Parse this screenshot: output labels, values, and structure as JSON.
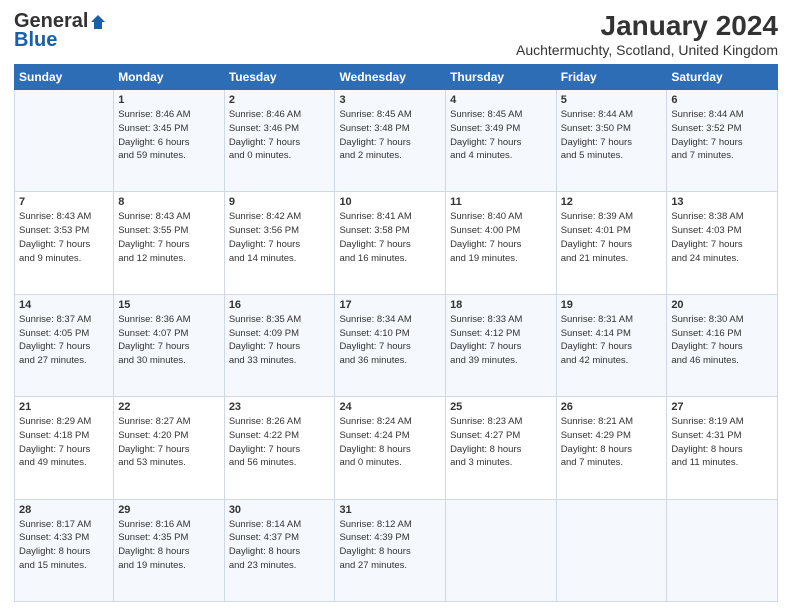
{
  "header": {
    "logo_general": "General",
    "logo_blue": "Blue",
    "main_title": "January 2024",
    "sub_title": "Auchtermuchty, Scotland, United Kingdom"
  },
  "columns": [
    "Sunday",
    "Monday",
    "Tuesday",
    "Wednesday",
    "Thursday",
    "Friday",
    "Saturday"
  ],
  "rows": [
    [
      {
        "day": "",
        "lines": []
      },
      {
        "day": "1",
        "lines": [
          "Sunrise: 8:46 AM",
          "Sunset: 3:45 PM",
          "Daylight: 6 hours",
          "and 59 minutes."
        ]
      },
      {
        "day": "2",
        "lines": [
          "Sunrise: 8:46 AM",
          "Sunset: 3:46 PM",
          "Daylight: 7 hours",
          "and 0 minutes."
        ]
      },
      {
        "day": "3",
        "lines": [
          "Sunrise: 8:45 AM",
          "Sunset: 3:48 PM",
          "Daylight: 7 hours",
          "and 2 minutes."
        ]
      },
      {
        "day": "4",
        "lines": [
          "Sunrise: 8:45 AM",
          "Sunset: 3:49 PM",
          "Daylight: 7 hours",
          "and 4 minutes."
        ]
      },
      {
        "day": "5",
        "lines": [
          "Sunrise: 8:44 AM",
          "Sunset: 3:50 PM",
          "Daylight: 7 hours",
          "and 5 minutes."
        ]
      },
      {
        "day": "6",
        "lines": [
          "Sunrise: 8:44 AM",
          "Sunset: 3:52 PM",
          "Daylight: 7 hours",
          "and 7 minutes."
        ]
      }
    ],
    [
      {
        "day": "7",
        "lines": [
          "Sunrise: 8:43 AM",
          "Sunset: 3:53 PM",
          "Daylight: 7 hours",
          "and 9 minutes."
        ]
      },
      {
        "day": "8",
        "lines": [
          "Sunrise: 8:43 AM",
          "Sunset: 3:55 PM",
          "Daylight: 7 hours",
          "and 12 minutes."
        ]
      },
      {
        "day": "9",
        "lines": [
          "Sunrise: 8:42 AM",
          "Sunset: 3:56 PM",
          "Daylight: 7 hours",
          "and 14 minutes."
        ]
      },
      {
        "day": "10",
        "lines": [
          "Sunrise: 8:41 AM",
          "Sunset: 3:58 PM",
          "Daylight: 7 hours",
          "and 16 minutes."
        ]
      },
      {
        "day": "11",
        "lines": [
          "Sunrise: 8:40 AM",
          "Sunset: 4:00 PM",
          "Daylight: 7 hours",
          "and 19 minutes."
        ]
      },
      {
        "day": "12",
        "lines": [
          "Sunrise: 8:39 AM",
          "Sunset: 4:01 PM",
          "Daylight: 7 hours",
          "and 21 minutes."
        ]
      },
      {
        "day": "13",
        "lines": [
          "Sunrise: 8:38 AM",
          "Sunset: 4:03 PM",
          "Daylight: 7 hours",
          "and 24 minutes."
        ]
      }
    ],
    [
      {
        "day": "14",
        "lines": [
          "Sunrise: 8:37 AM",
          "Sunset: 4:05 PM",
          "Daylight: 7 hours",
          "and 27 minutes."
        ]
      },
      {
        "day": "15",
        "lines": [
          "Sunrise: 8:36 AM",
          "Sunset: 4:07 PM",
          "Daylight: 7 hours",
          "and 30 minutes."
        ]
      },
      {
        "day": "16",
        "lines": [
          "Sunrise: 8:35 AM",
          "Sunset: 4:09 PM",
          "Daylight: 7 hours",
          "and 33 minutes."
        ]
      },
      {
        "day": "17",
        "lines": [
          "Sunrise: 8:34 AM",
          "Sunset: 4:10 PM",
          "Daylight: 7 hours",
          "and 36 minutes."
        ]
      },
      {
        "day": "18",
        "lines": [
          "Sunrise: 8:33 AM",
          "Sunset: 4:12 PM",
          "Daylight: 7 hours",
          "and 39 minutes."
        ]
      },
      {
        "day": "19",
        "lines": [
          "Sunrise: 8:31 AM",
          "Sunset: 4:14 PM",
          "Daylight: 7 hours",
          "and 42 minutes."
        ]
      },
      {
        "day": "20",
        "lines": [
          "Sunrise: 8:30 AM",
          "Sunset: 4:16 PM",
          "Daylight: 7 hours",
          "and 46 minutes."
        ]
      }
    ],
    [
      {
        "day": "21",
        "lines": [
          "Sunrise: 8:29 AM",
          "Sunset: 4:18 PM",
          "Daylight: 7 hours",
          "and 49 minutes."
        ]
      },
      {
        "day": "22",
        "lines": [
          "Sunrise: 8:27 AM",
          "Sunset: 4:20 PM",
          "Daylight: 7 hours",
          "and 53 minutes."
        ]
      },
      {
        "day": "23",
        "lines": [
          "Sunrise: 8:26 AM",
          "Sunset: 4:22 PM",
          "Daylight: 7 hours",
          "and 56 minutes."
        ]
      },
      {
        "day": "24",
        "lines": [
          "Sunrise: 8:24 AM",
          "Sunset: 4:24 PM",
          "Daylight: 8 hours",
          "and 0 minutes."
        ]
      },
      {
        "day": "25",
        "lines": [
          "Sunrise: 8:23 AM",
          "Sunset: 4:27 PM",
          "Daylight: 8 hours",
          "and 3 minutes."
        ]
      },
      {
        "day": "26",
        "lines": [
          "Sunrise: 8:21 AM",
          "Sunset: 4:29 PM",
          "Daylight: 8 hours",
          "and 7 minutes."
        ]
      },
      {
        "day": "27",
        "lines": [
          "Sunrise: 8:19 AM",
          "Sunset: 4:31 PM",
          "Daylight: 8 hours",
          "and 11 minutes."
        ]
      }
    ],
    [
      {
        "day": "28",
        "lines": [
          "Sunrise: 8:17 AM",
          "Sunset: 4:33 PM",
          "Daylight: 8 hours",
          "and 15 minutes."
        ]
      },
      {
        "day": "29",
        "lines": [
          "Sunrise: 8:16 AM",
          "Sunset: 4:35 PM",
          "Daylight: 8 hours",
          "and 19 minutes."
        ]
      },
      {
        "day": "30",
        "lines": [
          "Sunrise: 8:14 AM",
          "Sunset: 4:37 PM",
          "Daylight: 8 hours",
          "and 23 minutes."
        ]
      },
      {
        "day": "31",
        "lines": [
          "Sunrise: 8:12 AM",
          "Sunset: 4:39 PM",
          "Daylight: 8 hours",
          "and 27 minutes."
        ]
      },
      {
        "day": "",
        "lines": []
      },
      {
        "day": "",
        "lines": []
      },
      {
        "day": "",
        "lines": []
      }
    ]
  ]
}
